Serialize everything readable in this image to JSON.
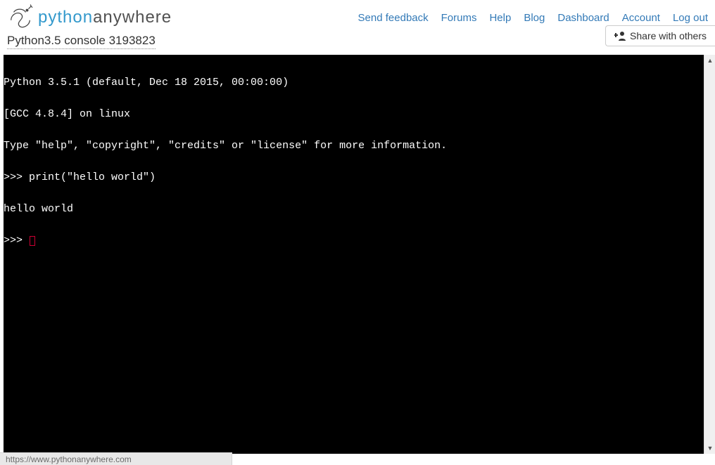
{
  "header": {
    "brand_py": "python",
    "brand_rest": "anywhere",
    "nav": {
      "send_feedback": "Send feedback",
      "forums": "Forums",
      "help": "Help",
      "blog": "Blog",
      "dashboard": "Dashboard",
      "account": "Account",
      "logout": "Log out"
    }
  },
  "subhead": {
    "console_title": "Python3.5 console 3193823",
    "share_label": "Share with others"
  },
  "terminal": {
    "lines": [
      "Python 3.5.1 (default, Dec 18 2015, 00:00:00)",
      "[GCC 4.8.4] on linux",
      "Type \"help\", \"copyright\", \"credits\" or \"license\" for more information.",
      ">>> print(\"hello world\")",
      "hello world"
    ],
    "prompt": ">>> "
  },
  "statusbar": {
    "text": "https://www.pythonanywhere.com"
  }
}
